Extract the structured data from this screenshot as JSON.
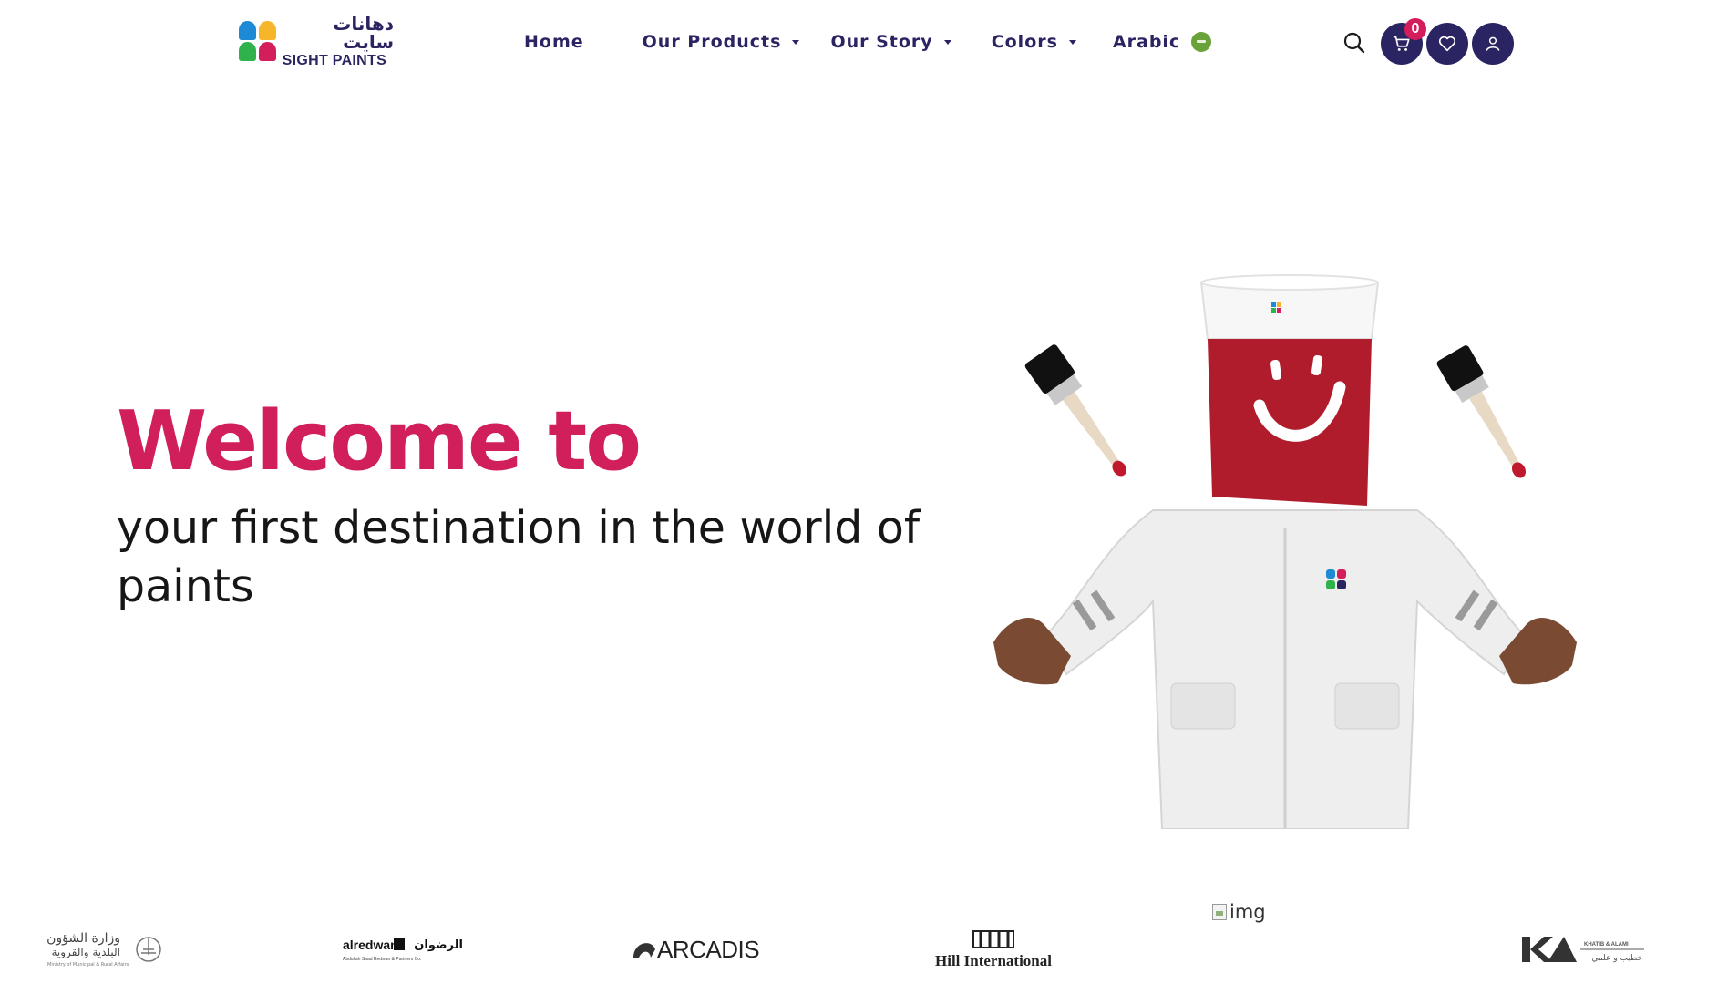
{
  "header": {
    "logo": {
      "arabic": "دهانات سايت",
      "english": "SIGHT PAINTS",
      "colors": [
        "#1e8ad6",
        "#f7b52a",
        "#2fb24c",
        "#d41e5c"
      ]
    },
    "nav": [
      {
        "label": "Home",
        "has_dropdown": false
      },
      {
        "label": "Our Products",
        "has_dropdown": true
      },
      {
        "label": "Our Story",
        "has_dropdown": true
      },
      {
        "label": "Colors",
        "has_dropdown": true
      },
      {
        "label": "Arabic",
        "has_dropdown": false,
        "icon": "saudi-flag-icon"
      }
    ],
    "cart_count": "0",
    "icons": [
      "search-icon",
      "cart-icon",
      "heart-icon",
      "user-icon"
    ],
    "accent_color": "#2b2462",
    "badge_color": "#d41e5c"
  },
  "hero": {
    "title": "Welcome to",
    "subtitle": "your first destination in the world of paints",
    "title_color": "#d01f5a",
    "image": "paint-bucket-mascot"
  },
  "partners": {
    "logos": [
      {
        "name": "وزارة الشؤون البلدية والقروية",
        "sub": "Ministry of Municipal & Rural Affairs"
      },
      {
        "name": "alredwan",
        "arabic": "الرضوان",
        "sub": "Abdullah Saad Redwan & Partners Co."
      },
      {
        "name": "ARCADIS"
      },
      {
        "name": "Hill International"
      },
      {
        "name": "img",
        "broken": true
      },
      {
        "name": "KHATIB & ALAMI",
        "arabic": "خطيب و علمي"
      }
    ]
  }
}
